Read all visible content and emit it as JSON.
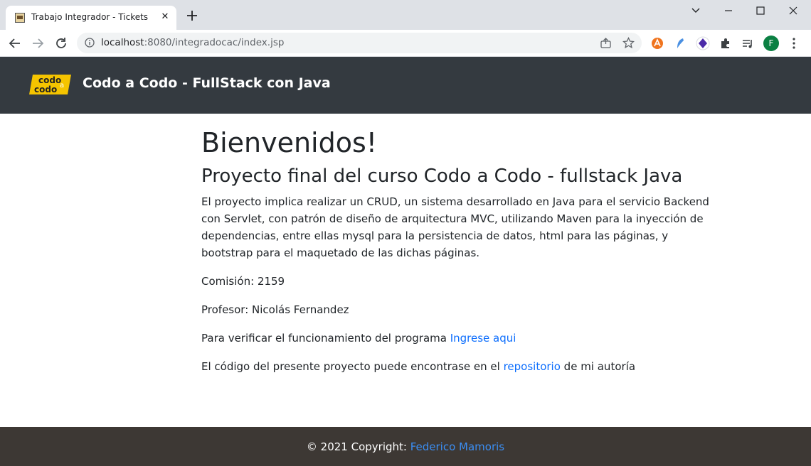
{
  "browser": {
    "tab_title": "Trabajo Integrador - Tickets",
    "tab_close": "✕",
    "new_tab": "+",
    "url_host": "localhost",
    "url_path": ":8080/integradocac/index.jsp",
    "profile_initial": "F"
  },
  "navbar": {
    "logo_line1": "codo",
    "logo_line2": "codo",
    "logo_a": "a",
    "brand": "Codo a Codo - FullStack con Java"
  },
  "main": {
    "heading": "Bienvenidos!",
    "subheading": "Proyecto final del curso Codo a Codo - fullstack Java",
    "description": "El proyecto implica realizar un CRUD, un sistema desarrollado en Java para el servicio Backend con Servlet, con patrón de diseño de arquitectura MVC, utilizando Maven para la inyección de dependencias, entre ellas mysql para la persistencia de datos, html para las páginas, y bootstrap para el maquetado de las dichas páginas.",
    "comision": "Comisión: 2159",
    "profesor": "Profesor: Nicolás Fernandez",
    "verify_text": "Para verificar el funcionamiento del programa ",
    "verify_link": "Ingrese aqui",
    "code_text_before": "El código del presente proyecto puede encontrase en el ",
    "code_link": "repositorio",
    "code_text_after": " de mi autoría"
  },
  "footer": {
    "copyright": "© 2021 Copyright: ",
    "author_link": "Federico Mamoris"
  },
  "colors": {
    "navbar_bg": "#343a40",
    "footer_bg": "#3d3834",
    "link": "#0d6efd",
    "logo_yellow": "#f5c400"
  }
}
